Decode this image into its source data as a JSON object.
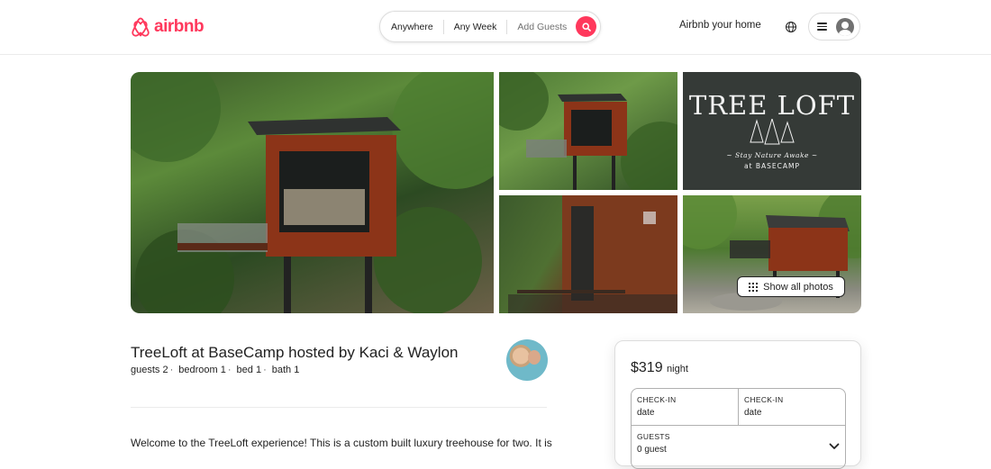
{
  "brand": {
    "name": "airbnb",
    "color": "#FF385C"
  },
  "search": {
    "location": "Anywhere",
    "dates": "Any Week",
    "guests": "Add Guests",
    "button_icon": "search-icon"
  },
  "nav": {
    "host_link": "Airbnb your home",
    "globe_icon": "globe-icon",
    "menu_icon": "hamburger-icon",
    "avatar_icon": "user-avatar-icon"
  },
  "gallery": {
    "sign": {
      "title": "TREE LOFT",
      "tagline": "~ Stay Nature Awake ~",
      "subtitle": "at BASECAMP"
    },
    "show_all_label": "Show all photos"
  },
  "listing": {
    "title": "TreeLoft at BaseCamp hosted by Kaci & Waylon",
    "details": [
      "guests 2",
      "bedroom 1",
      "bed 1",
      "bath 1"
    ],
    "separator": "·",
    "description": "Welcome to the TreeLoft experience! This is a custom built luxury treehouse for two. It is"
  },
  "booking": {
    "price": "$319",
    "price_unit": "night",
    "checkin_label": "CHECK-IN",
    "checkin_value": "date",
    "checkout_label": "CHECK-IN",
    "checkout_value": "date",
    "guests_label": "GUESTS",
    "guests_value": "0 guest"
  }
}
